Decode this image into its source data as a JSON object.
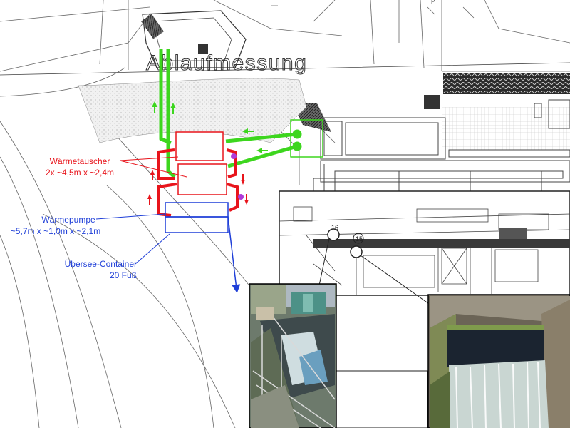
{
  "title": "Ablaufmessung",
  "labels": {
    "heat_exchanger": {
      "name": "Wärmetauscher",
      "dims": "2x ~4,5m x ~2,4m",
      "color": "#e8141b"
    },
    "heat_pump": {
      "name": "Wärmepumpe",
      "dims": "~5,7m x ~1,0m x ~2,1m",
      "color": "#1f3fd8"
    },
    "container": {
      "name": "Übersee-Container",
      "size": "20 Fuß",
      "color": "#1f3fd8"
    }
  },
  "inset_markers": [
    "16",
    "15"
  ],
  "colors": {
    "pipe_green": "#3dd61e",
    "heat_red": "#e8141b",
    "pump_blue": "#1f3fd8",
    "junction_purple": "#b03bd8",
    "plan_line": "#555555"
  },
  "icons": [
    "arrow-up-icon",
    "arrow-down-icon",
    "arrow-left-icon"
  ]
}
